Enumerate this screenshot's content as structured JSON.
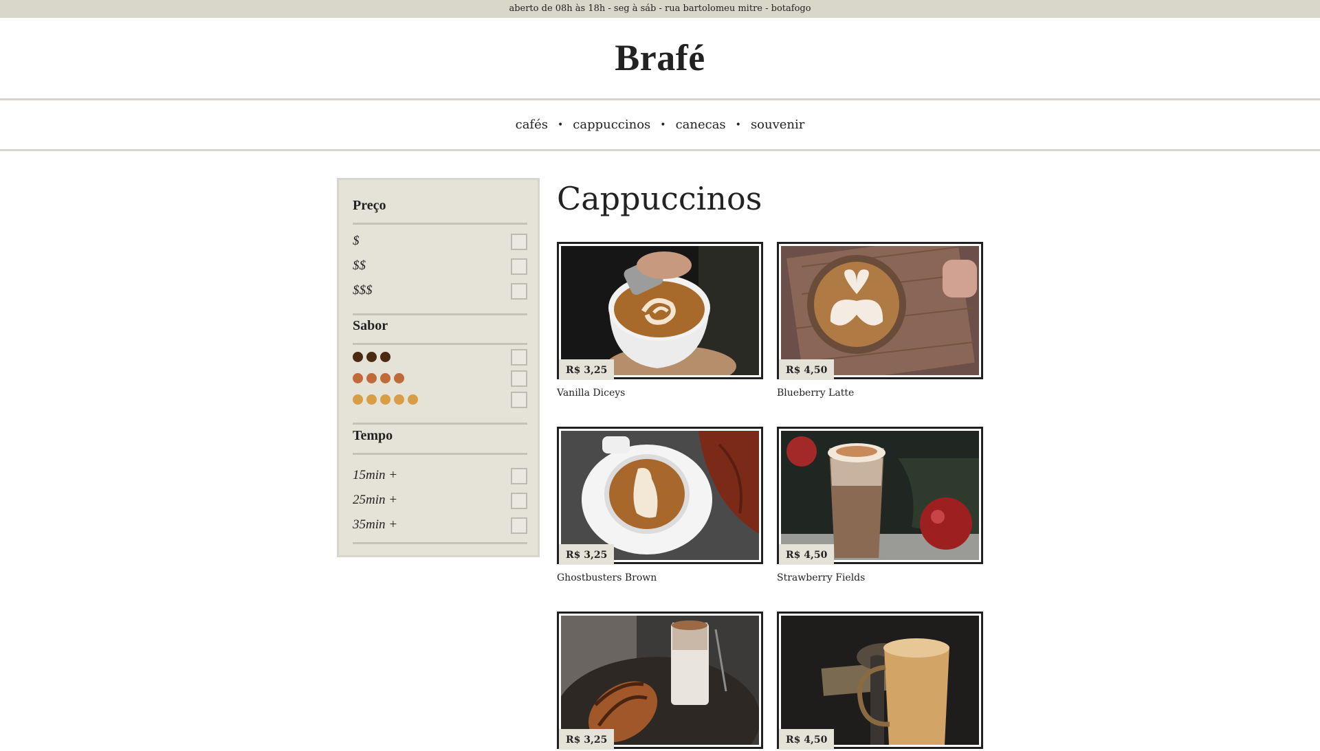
{
  "topbar": {
    "text": "aberto de 08h às 18h - seg à sáb - rua bartolomeu mitre - botafogo"
  },
  "brand": {
    "name": "Brafé"
  },
  "nav": {
    "items": [
      "cafés",
      "cappuccinos",
      "canecas",
      "souvenir"
    ],
    "separator": "•"
  },
  "filters": {
    "price": {
      "title": "Preço",
      "options": [
        "$",
        "$$",
        "$$$"
      ]
    },
    "flavor": {
      "title": "Sabor",
      "levels": [
        {
          "dots": 3,
          "color": "#4a2a10"
        },
        {
          "dots": 4,
          "color": "#c06a3a"
        },
        {
          "dots": 5,
          "color": "#d99e45"
        }
      ]
    },
    "time": {
      "title": "Tempo",
      "options": [
        "15min +",
        "25min +",
        "35min +"
      ]
    }
  },
  "page": {
    "title": "Cappuccinos"
  },
  "products": [
    {
      "name": "Vanilla Diceys",
      "price": "R$ 3,25"
    },
    {
      "name": "Blueberry Latte",
      "price": "R$ 4,50"
    },
    {
      "name": "Ghostbusters Brown",
      "price": "R$ 3,25"
    },
    {
      "name": "Strawberry Fields",
      "price": "R$ 4,50"
    },
    {
      "name": "",
      "price": "R$ 3,25"
    },
    {
      "name": "",
      "price": "R$ 4,50"
    }
  ],
  "colors": {
    "topbar": "#d9d6ca",
    "sidebar": "#e5e2d8",
    "text": "#222222",
    "frame": "#1f1f1f"
  }
}
